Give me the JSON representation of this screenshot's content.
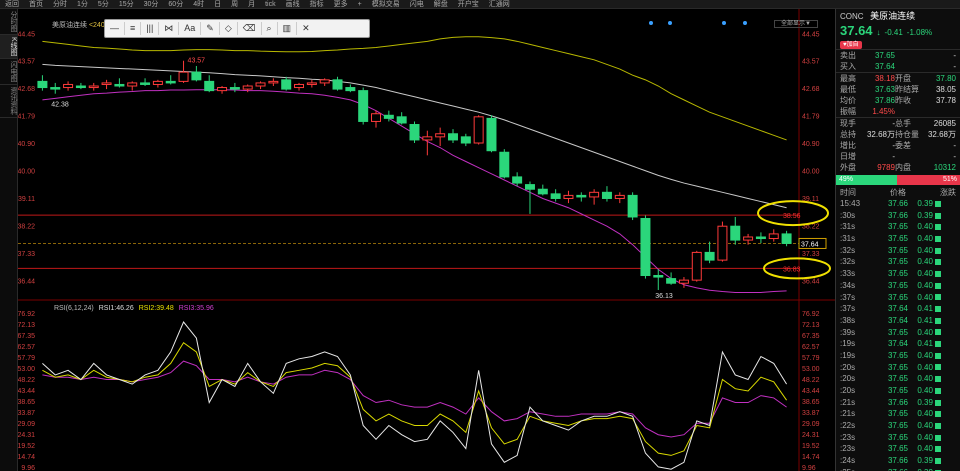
{
  "topbar": {
    "items": [
      "返回",
      "首页",
      "分时",
      "1分",
      "5分",
      "15分",
      "30分",
      "60分",
      "4时",
      "日",
      "周",
      "月",
      "tick",
      "画线",
      "指标",
      "更多",
      "+",
      "模拟交易",
      "闪电",
      "解盘",
      "开户宝",
      "汇通网"
    ]
  },
  "lefttabs": [
    "分时图",
    "K线图",
    "闪电图",
    "资讯资料"
  ],
  "symbol_title": {
    "name": "美原油连续",
    "period": "<240分钟>"
  },
  "draw_toolbar": [
    "—",
    "≡",
    "|||",
    "⋈",
    "Aa",
    "✎",
    "◇",
    "⌫",
    "⌕",
    "▥",
    "✕"
  ],
  "fq_button": "全部显示▼",
  "rsi_title": {
    "label": "RSI(6,12,24)",
    "rsi1": "RSI1:46.26",
    "rsi2": "RSI2:39.48",
    "rsi3": "RSI3:35.96"
  },
  "price_axis": [
    "44.45",
    "43.57",
    "42.68",
    "41.79",
    "40.90",
    "40.00",
    "39.11",
    "38.22",
    "37.33",
    "36.44"
  ],
  "rsi_axis": [
    "76.92",
    "72.13",
    "67.35",
    "62.57",
    "57.79",
    "53.00",
    "48.22",
    "43.44",
    "38.65",
    "33.87",
    "29.09",
    "24.31",
    "19.52",
    "14.74",
    "9.96"
  ],
  "annotations": {
    "high": "43.57",
    "low_left": "42.38",
    "low_right": "36.13",
    "line_upper": "38.56",
    "line_lower": "36.83",
    "last_price_tag": "37.64"
  },
  "chart_data": {
    "type": "candlestick",
    "ylim": [
      36.0,
      44.6
    ],
    "ohlc": [
      [
        42.9,
        43.1,
        42.6,
        42.7
      ],
      [
        42.7,
        42.85,
        42.5,
        42.65
      ],
      [
        42.7,
        42.9,
        42.6,
        42.8
      ],
      [
        42.75,
        42.85,
        42.65,
        42.7
      ],
      [
        42.7,
        42.85,
        42.6,
        42.75
      ],
      [
        42.8,
        42.95,
        42.65,
        42.85
      ],
      [
        42.8,
        43.0,
        42.7,
        42.75
      ],
      [
        42.75,
        42.9,
        42.6,
        42.85
      ],
      [
        42.85,
        43.0,
        42.75,
        42.8
      ],
      [
        42.8,
        42.95,
        42.7,
        42.9
      ],
      [
        42.9,
        43.1,
        42.8,
        42.85
      ],
      [
        42.9,
        43.57,
        42.85,
        43.2
      ],
      [
        43.2,
        43.4,
        42.9,
        42.95
      ],
      [
        42.9,
        43.1,
        42.55,
        42.6
      ],
      [
        42.6,
        42.75,
        42.5,
        42.7
      ],
      [
        42.7,
        42.85,
        42.55,
        42.65
      ],
      [
        42.65,
        42.8,
        42.55,
        42.75
      ],
      [
        42.75,
        42.9,
        42.65,
        42.85
      ],
      [
        42.85,
        43.0,
        42.75,
        42.9
      ],
      [
        42.95,
        43.05,
        42.6,
        42.65
      ],
      [
        42.7,
        42.85,
        42.6,
        42.8
      ],
      [
        42.8,
        42.95,
        42.7,
        42.85
      ],
      [
        42.85,
        43.0,
        42.75,
        42.95
      ],
      [
        42.95,
        43.05,
        42.6,
        42.65
      ],
      [
        42.7,
        42.8,
        42.55,
        42.6
      ],
      [
        42.6,
        42.7,
        41.5,
        41.6
      ],
      [
        41.6,
        41.95,
        41.4,
        41.85
      ],
      [
        41.8,
        41.95,
        41.6,
        41.7
      ],
      [
        41.75,
        41.9,
        41.5,
        41.55
      ],
      [
        41.5,
        41.6,
        40.9,
        41.0
      ],
      [
        41.0,
        41.3,
        40.5,
        41.1
      ],
      [
        41.1,
        41.4,
        40.8,
        41.2
      ],
      [
        41.2,
        41.35,
        40.9,
        41.0
      ],
      [
        41.1,
        41.2,
        40.8,
        40.9
      ],
      [
        40.9,
        41.8,
        40.85,
        41.75
      ],
      [
        41.7,
        41.8,
        40.6,
        40.65
      ],
      [
        40.6,
        40.7,
        39.75,
        39.8
      ],
      [
        39.8,
        39.95,
        39.5,
        39.6
      ],
      [
        39.55,
        39.65,
        38.6,
        39.4
      ],
      [
        39.4,
        39.55,
        39.2,
        39.25
      ],
      [
        39.25,
        39.4,
        39.0,
        39.1
      ],
      [
        39.1,
        39.35,
        38.95,
        39.2
      ],
      [
        39.2,
        39.3,
        39.0,
        39.15
      ],
      [
        39.15,
        39.4,
        38.9,
        39.3
      ],
      [
        39.3,
        39.5,
        39.0,
        39.1
      ],
      [
        39.1,
        39.3,
        38.95,
        39.2
      ],
      [
        39.2,
        39.3,
        38.4,
        38.5
      ],
      [
        38.45,
        38.55,
        36.5,
        36.6
      ],
      [
        36.6,
        36.8,
        36.13,
        36.55
      ],
      [
        36.5,
        36.7,
        36.3,
        36.35
      ],
      [
        36.35,
        36.55,
        36.2,
        36.45
      ],
      [
        36.45,
        37.4,
        36.4,
        37.35
      ],
      [
        37.35,
        37.7,
        37.0,
        37.1
      ],
      [
        37.1,
        38.35,
        37.05,
        38.2
      ],
      [
        38.2,
        38.5,
        37.6,
        37.75
      ],
      [
        37.75,
        37.95,
        37.6,
        37.85
      ],
      [
        37.85,
        38.0,
        37.65,
        37.8
      ],
      [
        37.8,
        38.1,
        37.7,
        37.95
      ],
      [
        37.95,
        38.05,
        37.55,
        37.64
      ]
    ],
    "ma_upper": [
      44.2,
      44.15,
      44.1,
      44.05,
      44.0,
      43.98,
      43.95,
      43.92,
      43.9,
      43.9,
      43.9,
      43.92,
      43.93,
      43.93,
      43.92,
      43.9,
      43.9,
      43.88,
      43.87,
      43.86,
      43.86,
      43.87,
      43.9,
      43.92,
      43.95,
      43.97,
      44.0,
      44.05,
      44.1,
      44.15,
      44.2,
      44.28,
      44.33,
      44.35,
      44.35,
      44.32,
      44.28,
      44.2,
      44.1,
      44.0,
      43.9,
      43.8,
      43.7,
      43.6,
      43.45,
      43.3,
      43.1,
      42.95,
      42.75,
      42.5,
      42.3,
      42.1,
      41.9,
      41.75,
      41.6,
      41.45,
      41.3,
      41.15,
      41.0
    ],
    "ma_mid": [
      43.45,
      43.42,
      43.4,
      43.38,
      43.36,
      43.34,
      43.32,
      43.3,
      43.28,
      43.26,
      43.24,
      43.22,
      43.2,
      43.18,
      43.15,
      43.12,
      43.1,
      43.08,
      43.05,
      43.02,
      43.0,
      42.97,
      42.95,
      42.9,
      42.85,
      42.78,
      42.7,
      42.6,
      42.5,
      42.4,
      42.3,
      42.2,
      42.1,
      42.0,
      41.9,
      41.78,
      41.65,
      41.5,
      41.35,
      41.2,
      41.05,
      40.9,
      40.75,
      40.6,
      40.45,
      40.3,
      40.15,
      40.0,
      39.85,
      39.72,
      39.6,
      39.5,
      39.4,
      39.3,
      39.2,
      39.1,
      39.0,
      38.9,
      38.8
    ],
    "ma_lower": [
      42.3,
      42.35,
      42.4,
      42.45,
      42.5,
      42.52,
      42.55,
      42.57,
      42.6,
      42.6,
      42.62,
      42.62,
      42.63,
      42.63,
      42.63,
      42.62,
      42.6,
      42.6,
      42.58,
      42.55,
      42.52,
      42.5,
      42.45,
      42.38,
      42.3,
      42.15,
      41.95,
      41.7,
      41.45,
      41.2,
      40.95,
      40.75,
      40.5,
      40.3,
      40.1,
      39.9,
      39.7,
      39.5,
      39.3,
      39.1,
      38.95,
      38.8,
      38.6,
      38.4,
      38.2,
      37.95,
      37.6,
      37.2,
      36.8,
      36.5,
      36.3,
      36.2,
      36.12,
      36.08,
      36.05,
      36.05,
      36.05,
      36.08,
      36.1
    ],
    "hlines": [
      38.56,
      36.83
    ],
    "last_price": 37.64,
    "rsi": {
      "ylim": [
        9.96,
        76.92
      ],
      "rsi1": [
        55,
        50,
        52,
        48,
        55,
        50,
        48,
        46,
        50,
        52,
        60,
        73,
        66,
        38,
        48,
        45,
        55,
        47,
        42,
        55,
        57,
        58,
        60,
        58,
        50,
        28,
        22,
        28,
        24,
        21,
        22,
        30,
        25,
        18,
        52,
        20,
        12,
        15,
        36,
        30,
        28,
        26,
        30,
        32,
        32,
        34,
        32,
        16,
        10,
        9,
        12,
        30,
        28,
        60,
        50,
        48,
        58,
        55,
        46
      ],
      "rsi2": [
        52,
        49,
        50,
        48,
        52,
        49,
        48,
        47,
        49,
        50,
        55,
        64,
        60,
        45,
        48,
        46,
        51,
        47,
        45,
        51,
        52,
        53,
        55,
        54,
        49,
        35,
        30,
        33,
        30,
        28,
        28,
        33,
        30,
        25,
        43,
        27,
        20,
        22,
        32,
        30,
        29,
        28,
        30,
        31,
        31,
        32,
        31,
        21,
        16,
        15,
        17,
        28,
        27,
        48,
        44,
        43,
        49,
        47,
        39
      ],
      "rsi3": [
        50,
        49,
        49,
        48,
        49,
        48,
        48,
        47,
        48,
        49,
        51,
        56,
        54,
        48,
        48,
        47,
        49,
        47,
        46,
        49,
        50,
        50,
        52,
        51,
        48,
        41,
        38,
        39,
        37,
        36,
        36,
        38,
        36,
        33,
        40,
        34,
        30,
        31,
        34,
        33,
        32,
        32,
        33,
        33,
        33,
        34,
        33,
        27,
        24,
        23,
        24,
        29,
        29,
        40,
        38,
        38,
        41,
        40,
        36
      ]
    }
  },
  "panel": {
    "code": "CONC",
    "name": "美原油连续",
    "price": "37.64",
    "arrow": "↓",
    "change": "-0.41",
    "change_pct": "-1.08%",
    "badge": "♥加自",
    "quotes1": [
      {
        "l": "卖出",
        "v": "37.65",
        "l2": "",
        "v2": "-"
      },
      {
        "l": "买入",
        "v": "37.64",
        "l2": "",
        "v2": "-"
      }
    ],
    "quotes2": [
      {
        "l": "最高",
        "v": "38.18",
        "l2": "开盘",
        "v2": "37.80"
      },
      {
        "l": "最低",
        "v": "37.63",
        "l2": "昨结算",
        "v2": "38.05"
      },
      {
        "l": "均价",
        "v": "37.86",
        "l2": "昨收",
        "v2": "37.78"
      },
      {
        "l": "振幅",
        "v": "1.45%",
        "l2": "",
        "v2": ""
      }
    ],
    "quotes3": [
      {
        "l": "现手",
        "v": "-",
        "l2": "总手",
        "v2": "26085"
      },
      {
        "l": "总持",
        "v": "32.68万",
        "l2": "持仓量",
        "v2": "32.68万"
      },
      {
        "l": "增比",
        "v": "-",
        "l2": "委差",
        "v2": "-"
      },
      {
        "l": "日增",
        "v": "-",
        "l2": "",
        "v2": "-"
      },
      {
        "l": "外盘",
        "v": "9789",
        "l2": "内盘",
        "v2": "10312"
      }
    ],
    "ratio": {
      "buy": "49%",
      "sell": "51%",
      "buy_frac": 0.49
    },
    "tick_head": [
      "时间",
      "价格",
      "涨跌"
    ],
    "ticks": [
      [
        "15:43",
        "37.66",
        "0.39"
      ],
      [
        ":30s",
        "37.66",
        "0.39"
      ],
      [
        ":31s",
        "37.65",
        "0.40"
      ],
      [
        ":31s",
        "37.65",
        "0.40"
      ],
      [
        ":32s",
        "37.65",
        "0.40"
      ],
      [
        ":32s",
        "37.65",
        "0.40"
      ],
      [
        ":33s",
        "37.65",
        "0.40"
      ],
      [
        ":34s",
        "37.65",
        "0.40"
      ],
      [
        ":37s",
        "37.65",
        "0.40"
      ],
      [
        ":37s",
        "37.64",
        "0.41"
      ],
      [
        ":38s",
        "37.64",
        "0.41"
      ],
      [
        ":39s",
        "37.65",
        "0.40"
      ],
      [
        ":19s",
        "37.64",
        "0.41"
      ],
      [
        ":19s",
        "37.65",
        "0.40"
      ],
      [
        ":20s",
        "37.65",
        "0.40"
      ],
      [
        ":20s",
        "37.65",
        "0.40"
      ],
      [
        ":20s",
        "37.65",
        "0.40"
      ],
      [
        ":21s",
        "37.66",
        "0.39"
      ],
      [
        ":21s",
        "37.65",
        "0.40"
      ],
      [
        ":22s",
        "37.65",
        "0.40"
      ],
      [
        ":23s",
        "37.65",
        "0.40"
      ],
      [
        ":23s",
        "37.65",
        "0.40"
      ],
      [
        ":24s",
        "37.66",
        "0.39"
      ],
      [
        ":25s",
        "37.66",
        "0.39"
      ]
    ]
  }
}
